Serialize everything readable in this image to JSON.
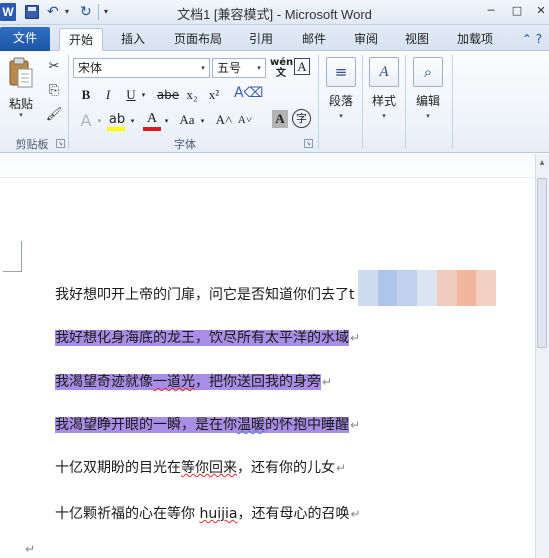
{
  "window": {
    "title": "文档1 [兼容模式] - Microsoft Word",
    "app_icon": "W",
    "minimize": "─",
    "maximize": "□",
    "close": "✕"
  },
  "qat": {
    "undo": "↶",
    "redo": "↻",
    "dropdown": "▾",
    "customize": "▾"
  },
  "tabs": {
    "file": "文件",
    "home": "开始",
    "insert": "插入",
    "layout": "页面布局",
    "references": "引用",
    "mailings": "邮件",
    "review": "审阅",
    "view": "视图",
    "addins": "加载项",
    "help": "⌃ ?"
  },
  "clipboard": {
    "paste": "粘贴",
    "paste_arrow": "▾",
    "cut": "✂",
    "copy": "⎘",
    "painter": "🖌",
    "group_label": "剪贴板",
    "launcher": "↘"
  },
  "font": {
    "name": "宋体",
    "size": "五号",
    "dd": "▾",
    "wen": "wén\n文",
    "char_border": "A",
    "bold": "B",
    "italic": "I",
    "underline": "U",
    "underline_dd": "▾",
    "strike": "abe",
    "sub": "x₂",
    "sup": "x²",
    "clear": "A⌫",
    "text_effect": "A",
    "text_effect_dd": "▾",
    "highlight": "ab",
    "highlight_dd": "▾",
    "font_color": "A",
    "font_color_dd": "▾",
    "change_case": "Aa",
    "change_case_dd": "▾",
    "grow": "A˄",
    "shrink": "A˅",
    "shade": "A",
    "enclose": "字",
    "group_label": "字体",
    "launcher": "↘",
    "highlight_color": "#ffff00",
    "font_color_value": "#e0171e"
  },
  "paragraph": {
    "label": "段落",
    "arrow": "▾",
    "icon": "≡"
  },
  "styles": {
    "label": "样式",
    "arrow": "▾",
    "icon": "A"
  },
  "editing": {
    "label": "编辑",
    "arrow": "▾",
    "icon": "⌕"
  },
  "document": {
    "lines": [
      "我好想叩开上帝的门扉，问它是否知道你们去了t",
      "我好想化身海底的龙王，饮尽所有太平洋的水域",
      "我渴望奇迹就像一道光，把你送回我的身旁",
      "我渴望睁开眼的一瞬，是在你温暖的怀抱中睡醒",
      "十亿双期盼的目光在等你回来，还有你的儿女",
      "十亿颗祈福的心在等你 huijia，还有母心的召唤"
    ],
    "line6_pre": "十亿颗祈福的心在等你 ",
    "line6_typo": "huijia",
    "line6_post": "，还有母心的召唤",
    "line4_pre": "我渴望睁开眼的一瞬，是在你",
    "line4_sq": "温暖",
    "line4_post": "的怀抱中睡醒",
    "line3_pre": "我渴望奇迹就像",
    "line3_sq": "一道光",
    "line3_post": "，把你送回我的身旁",
    "line5_pre": "十亿双期盼的目光在",
    "line5_sq": "等你回来",
    "line5_post": "，还有你的儿女",
    "para_mark": "↵",
    "highlight_color": "#a98ee8"
  }
}
